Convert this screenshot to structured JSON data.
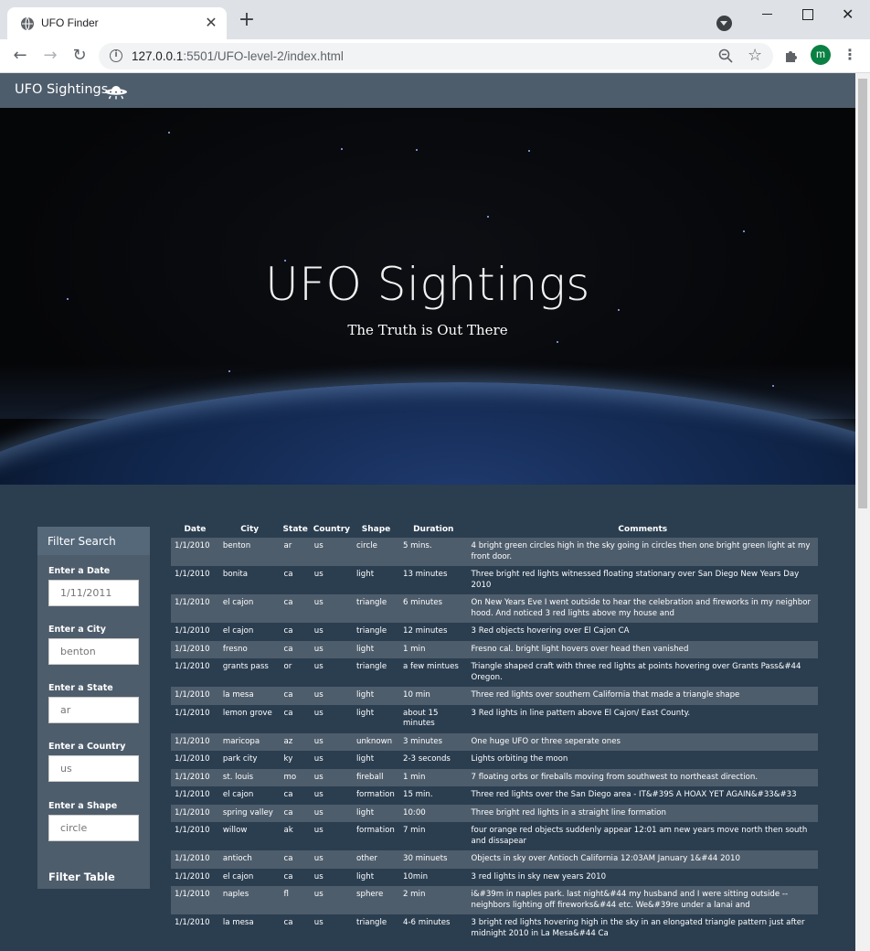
{
  "browser": {
    "tab_title": "UFO Finder",
    "url_host": "127.0.0.1",
    "url_rest": ":5501/UFO-level-2/index.html",
    "profile_initial": "m",
    "new_tab_glyph": "+",
    "close_glyph": "✕"
  },
  "navbar": {
    "brand": "UFO Sightings",
    "brand_icon": "ufo-icon"
  },
  "hero": {
    "title": "UFO Sightings",
    "subtitle": "The Truth is Out There"
  },
  "filters": {
    "header": "Filter Search",
    "date": {
      "label": "Enter a Date",
      "placeholder": "1/11/2011"
    },
    "city": {
      "label": "Enter a City",
      "placeholder": "benton"
    },
    "state": {
      "label": "Enter a State",
      "placeholder": "ar"
    },
    "country": {
      "label": "Enter a Country",
      "placeholder": "us"
    },
    "shape": {
      "label": "Enter a Shape",
      "placeholder": "circle"
    },
    "button": "Filter Table"
  },
  "table": {
    "headers": [
      "Date",
      "City",
      "State",
      "Country",
      "Shape",
      "Duration",
      "Comments"
    ],
    "rows": [
      [
        "1/1/2010",
        "benton",
        "ar",
        "us",
        "circle",
        "5 mins.",
        "4 bright green circles high in the sky going in circles then one bright green light at my front door."
      ],
      [
        "1/1/2010",
        "bonita",
        "ca",
        "us",
        "light",
        "13 minutes",
        "Three bright red lights witnessed floating stationary over San Diego New Years Day 2010"
      ],
      [
        "1/1/2010",
        "el cajon",
        "ca",
        "us",
        "triangle",
        "6 minutes",
        "On New Years Eve I went outside to hear the celebration and fireworks in my neighbor hood. And noticed 3 red lights above my house and"
      ],
      [
        "1/1/2010",
        "el cajon",
        "ca",
        "us",
        "triangle",
        "12 minutes",
        "3 Red objects hovering over El Cajon CA"
      ],
      [
        "1/1/2010",
        "fresno",
        "ca",
        "us",
        "light",
        "1 min",
        "Fresno cal. bright light hovers over head then vanished"
      ],
      [
        "1/1/2010",
        "grants pass",
        "or",
        "us",
        "triangle",
        "a few mintues",
        "Triangle shaped craft with three red lights at points hovering over Grants Pass&#44 Oregon."
      ],
      [
        "1/1/2010",
        "la mesa",
        "ca",
        "us",
        "light",
        "10 min",
        "Three red lights over southern California that made a triangle shape"
      ],
      [
        "1/1/2010",
        "lemon grove",
        "ca",
        "us",
        "light",
        "about 15 minutes",
        "3 Red lights in line pattern above El Cajon/ East County."
      ],
      [
        "1/1/2010",
        "maricopa",
        "az",
        "us",
        "unknown",
        "3 minutes",
        "One huge UFO or three seperate ones"
      ],
      [
        "1/1/2010",
        "park city",
        "ky",
        "us",
        "light",
        "2-3 seconds",
        "Lights orbiting the moon"
      ],
      [
        "1/1/2010",
        "st. louis",
        "mo",
        "us",
        "fireball",
        "1 min",
        "7 floating orbs or fireballs moving from southwest to northeast direction."
      ],
      [
        "1/1/2010",
        "el cajon",
        "ca",
        "us",
        "formation",
        "15 min.",
        "Three red lights over the San Diego area - IT&#39S A HOAX YET AGAIN&#33&#33"
      ],
      [
        "1/1/2010",
        "spring valley",
        "ca",
        "us",
        "light",
        "10:00",
        "Three bright red lights in a straight line formation"
      ],
      [
        "1/1/2010",
        "willow",
        "ak",
        "us",
        "formation",
        "7 min",
        "four orange red objects suddenly appear 12:01 am new years move north then south and dissapear"
      ],
      [
        "1/1/2010",
        "antioch",
        "ca",
        "us",
        "other",
        "30 minuets",
        "Objects in sky over Antioch California 12:03AM January 1&#44 2010"
      ],
      [
        "1/1/2010",
        "el cajon",
        "ca",
        "us",
        "light",
        "10min",
        "3 red lights in sky new years 2010"
      ],
      [
        "1/1/2010",
        "naples",
        "fl",
        "us",
        "sphere",
        "2 min",
        "i&#39m in naples park. last night&#44 my husband and I were sitting outside --neighbors lighting off fireworks&#44 etc. We&#39re under a lanai and"
      ],
      [
        "1/1/2010",
        "la mesa",
        "ca",
        "us",
        "triangle",
        "4-6 minutes",
        "3 bright red lights hovering high in the sky in an elongated triangle pattern just after midnight 2010 in La Mesa&#44 Ca"
      ]
    ]
  }
}
